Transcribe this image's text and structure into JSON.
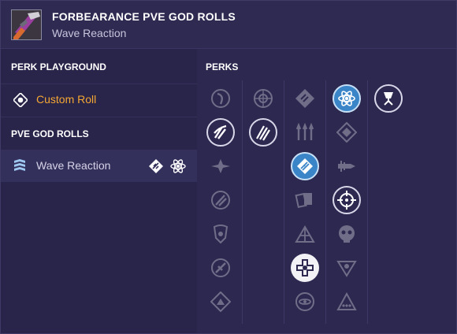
{
  "header": {
    "title": "FORBEARANCE PVE GOD ROLLS",
    "subtitle": "Wave Reaction"
  },
  "left": {
    "perk_playground_title": "PERK PLAYGROUND",
    "custom_roll_label": "Custom Roll",
    "pve_god_rolls_title": "PVE GOD ROLLS",
    "wave_reaction_label": "Wave Reaction"
  },
  "perks": {
    "title": "PERKS",
    "columns": [
      [
        "scope-icon",
        "target-icon",
        "spark-icon",
        "slash-wave-icon",
        "broken-ring-icon",
        "crossed-tools-icon",
        "pyramid-icon"
      ],
      [
        "slash-claw-icon"
      ],
      [
        "diamond-icon",
        "arrows-up-icon",
        "diamond-spike-icon",
        "cards-icon",
        "tent-icon",
        "cross-burst-icon",
        "atom-ring-icon"
      ],
      [
        "atom-icon",
        "gem-icon",
        "bullet-icon",
        "crosshair-icon",
        "skull-icon",
        "triangle-icon",
        "triangle-dots-icon"
      ],
      [
        "chalice-icon"
      ]
    ]
  },
  "colors": {
    "accent_orange": "#f5a733",
    "selected_blue": "#3a84c8",
    "background": "#282446"
  }
}
